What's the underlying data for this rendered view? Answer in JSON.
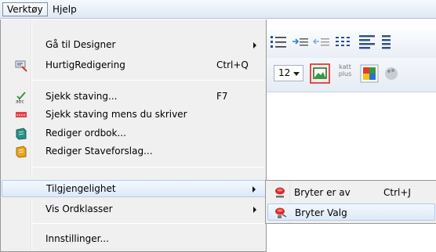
{
  "menubar": {
    "items": [
      {
        "label": "Verktøy"
      },
      {
        "label": "Hjelp"
      }
    ]
  },
  "menu": {
    "items": [
      {
        "label": "Gå til Designer",
        "shortcut": "",
        "icon": "none",
        "submenu": true
      },
      {
        "label": "HurtigRedigering",
        "shortcut": "Ctrl+Q",
        "icon": "quick-edit-icon",
        "submenu": false
      },
      {
        "label": "Sjekk staving...",
        "shortcut": "F7",
        "icon": "spellcheck-abc-icon",
        "submenu": false
      },
      {
        "label": "Sjekk staving mens du skriver",
        "shortcut": "",
        "icon": "spellcheck-live-icon",
        "submenu": false
      },
      {
        "label": "Rediger ordbok...",
        "shortcut": "",
        "icon": "dictionary-icon",
        "submenu": false
      },
      {
        "label": "Rediger Staveforslag...",
        "shortcut": "",
        "icon": "spelling-suggestions-icon",
        "submenu": false
      },
      {
        "label": "Tilgjengelighet",
        "shortcut": "",
        "icon": "none",
        "submenu": true
      },
      {
        "label": "Vis Ordklasser",
        "shortcut": "",
        "icon": "none",
        "submenu": true
      },
      {
        "label": "Innstillinger...",
        "shortcut": "",
        "icon": "none",
        "submenu": false
      }
    ]
  },
  "submenu": {
    "items": [
      {
        "label": "Bryter er av",
        "shortcut": "Ctrl+J",
        "icon": "switch-off-icon"
      },
      {
        "label": "Bryter Valg",
        "shortcut": "",
        "icon": "switch-options-icon"
      }
    ]
  },
  "toolbar": {
    "font_size": "12",
    "kattplus_line1": "katt",
    "kattplus_line2": "plus"
  },
  "colors": {
    "highlight_border": "#aecbf0",
    "menu_background": "#f0f0f0"
  }
}
